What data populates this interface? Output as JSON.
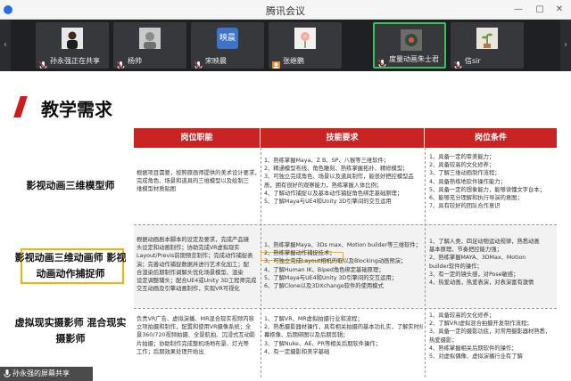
{
  "window": {
    "title": "腾讯会议"
  },
  "participants": [
    {
      "name": "孙永强正在共享",
      "avatar": "photo-man",
      "muted": true
    },
    {
      "name": "杨帅",
      "avatar": "photo-gray",
      "muted": true
    },
    {
      "name": "宋映晨",
      "avatar_text": "映晨",
      "muted": true
    },
    {
      "name": "张继鹏",
      "avatar": "photo-flower",
      "muted": false
    },
    {
      "name": "度量动画朱士君",
      "avatar": "photo-cartoon",
      "muted": true,
      "active": true
    },
    {
      "name": "信sir",
      "avatar": "photo-plant",
      "muted": true
    }
  ],
  "slide": {
    "title": "教学需求",
    "headers": [
      "岗位职能",
      "技能要求",
      "岗位条件"
    ],
    "rows": [
      {
        "role": [
          "影视动画三维模型师"
        ],
        "duties": [
          "根据项目需要，按照原画师提供的美术设计要求，",
          "完成角色、场景和道具的三维模型以及绘制三",
          "维模型材质贴图"
        ],
        "skills": [
          "1、熟练掌握Maya、Z B、SP、八猴等三维软件；",
          "2、精通模型布线、角色雕刻、熟练掌握拓扑、精修模型；",
          "3、可独立完成角色、场景以及道具制作，能很好把控模型品",
          "质，拥有很好的观察能力，熟练掌握人体比例；",
          "4、了解动作捕捉以及基本动作捕捉角色绑定基础原理；",
          "5、了解Maya与UE4和Unity 3D引擎间的交互运用"
        ],
        "conditions": [
          "1、具备一定的审美能力；",
          "2、具备较高的文化修养；",
          "3、了解三维动画制作流程；",
          "4、具备熟练地软件操作能力；",
          "5、具备一定的想象能力，能够读懂文字台本；",
          "6、能够充分理解和执行导演的意图；",
          "7、具有较好的团队合作意识"
        ]
      },
      {
        "role": [
          "影视动画三维动画师",
          "影视动画动作捕捉师"
        ],
        "duties": [
          "根据动画剧本脚本的设定及要求，完成产品镜",
          "头设定和动画制作；协助完成VR虚拟现实",
          "Layout/Previs前期预览制作；完成动作捕捉表",
          "演；完善动作捕捉数据并进行艺术化加工；配",
          "合渲染后期制作调解头优化场景模型、渲染",
          "设定调整辅头；配合UE4或Unity 3D工程师完成",
          "交互动画及引擎动画制作，实现VR可视化"
        ],
        "skills": [
          "1、熟练掌握Maya、3Ds max、Motion builder等三维软件；",
          "2、熟练掌握动作捕捉技术；",
          "3、可独立完成Layout相机的取以及Blocking动画预演；",
          "4、了解Human IK、Biped角色绑定基础原理；",
          "5、了解Maya与UE4和Unity 3D引擎间的交互运用；",
          "6、了解Clone以及3DXchange软件的使用模式"
        ],
        "conditions": [
          "1、了解人类、四足动物运动规律，熟悉动画",
          "基本原理、节奏把控能力强；",
          "2、熟练掌握MAYA、3DMax、Motion",
          "builder软件的操作；",
          "3、有一定的镜头感，对Pose敏感；",
          "4、热爱动画，热爱表演，对表演富有激情"
        ]
      },
      {
        "role": [
          "虚拟现实摄影师",
          "混合现实摄影师"
        ],
        "duties": [
          "负责VR广告、虚拟演播、MR混合现实视频内容",
          "立项拍摄和制作，配置和使用VR摄像系统；全",
          "景360/720视频拍摄、全景航拍、沉浸式互动影",
          "片拍摄；协助制作完成整机场地布景、灯光等",
          "工作；后期效果处理开始出"
        ],
        "skills": [
          "1、了解VR、MR虚拟拍摄行业和流程；",
          "2、熟悉摄影器材操作，具有相关拍摄的基本功扎实，了解实时绿",
          "幕抠像、后期绑图以及后期剪辑；",
          "3、了解Nuke、AE、PR等相关后期软件操作；",
          "4、有一定摄影和美学基础"
        ],
        "conditions": [
          "1、具备较高的文化修养；",
          "2、了解VR/虚拟混合拍摄开发制作流程；",
          "3、具备一定的摄影功底，对常用摄影器材熟悉，",
          "热爱摄影；",
          "4、熟练掌握相关后期软件的操作；",
          "5、对虚拟偶像、虚拟演播行业有了解"
        ]
      }
    ]
  },
  "share_indicator": {
    "label": "孙永强的屏幕共享"
  },
  "colors": {
    "accent_red": "#c82423",
    "highlight": "#f2b400",
    "active_speaker": "#3ac25a"
  }
}
